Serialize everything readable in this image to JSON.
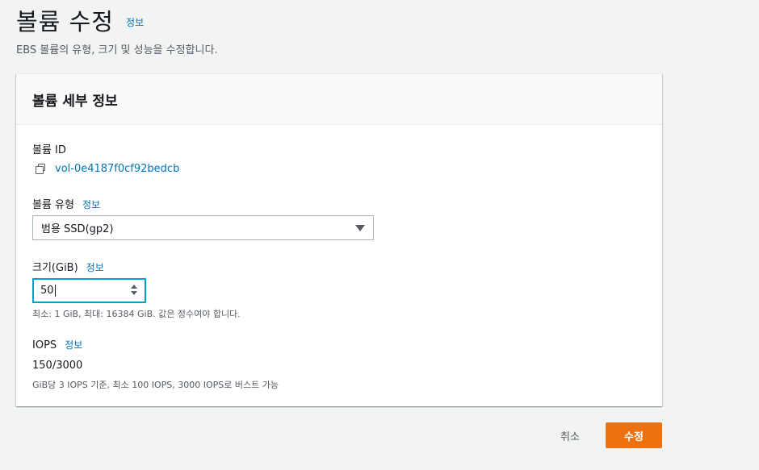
{
  "header": {
    "title": "볼륨 수정",
    "info_link": "정보",
    "description": "EBS 볼륨의 유형, 크기 및 성능을 수정합니다."
  },
  "panel": {
    "title": "볼륨 세부 정보",
    "volume_id": {
      "label": "볼륨 ID",
      "value": "vol-0e4187f0cf92bedcb",
      "icon": "copy-icon"
    },
    "volume_type": {
      "label": "볼륨 유형",
      "info_link": "정보",
      "selected": "범용 SSD(gp2)"
    },
    "size": {
      "label": "크기(GiB)",
      "info_link": "정보",
      "value": "50",
      "hint": "최소: 1 GiB, 최대: 16384 GiB. 값은 정수여야 합니다."
    },
    "iops": {
      "label": "IOPS",
      "info_link": "정보",
      "value": "150/3000",
      "hint": "GiB당 3 IOPS 기준, 최소 100 IOPS, 3000 IOPS로 버스트 가능"
    }
  },
  "actions": {
    "cancel_label": "취소",
    "submit_label": "수정"
  },
  "colors": {
    "link": "#0073bb",
    "primary_button": "#ec7211",
    "focus_border": "#00a1c9"
  }
}
